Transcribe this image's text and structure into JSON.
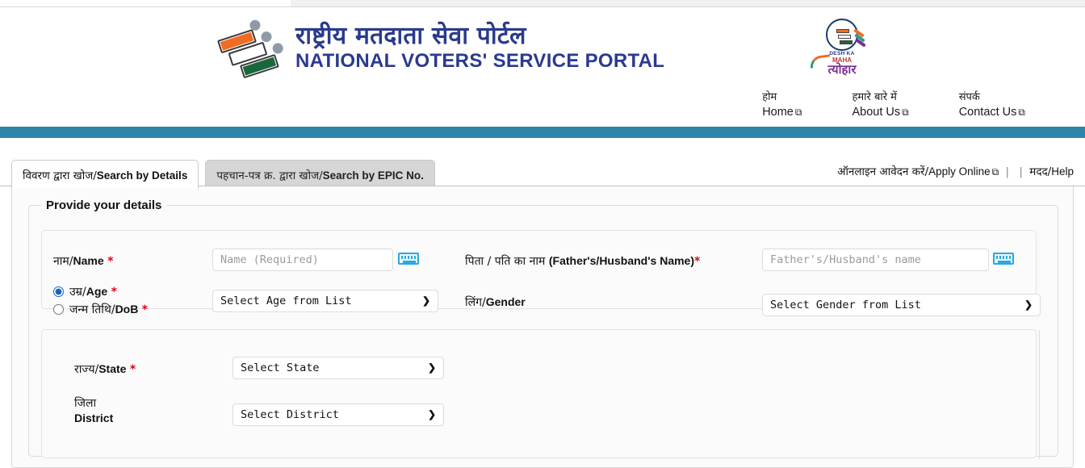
{
  "site": {
    "title_hi": "राष्ट्रीय मतदाता सेवा पोर्टल",
    "title_en": "NATIONAL VOTERS' SERVICE PORTAL",
    "logo_alt": "election-commission-of-india-logo",
    "campaign_logo": {
      "line1": "DESH KA",
      "line2": "MAHA",
      "line3": "त्योहार"
    },
    "brand_color": "#2a3a8f",
    "band_color": "#2E85AB"
  },
  "nav": {
    "items": [
      {
        "hi": "होम",
        "en": "Home",
        "external": "⧉"
      },
      {
        "hi": "हमारे बारे में",
        "en": "About Us",
        "external": "⧉"
      },
      {
        "hi": "संपर्क",
        "en": "Contact Us",
        "external": "⧉"
      }
    ]
  },
  "tabs": [
    {
      "hi": "विवरण द्वारा खोज/",
      "en": "Search by Details",
      "active": true
    },
    {
      "hi": "पहचान-पत्र क्र. द्वारा खोज/",
      "en": "Search by EPIC No.",
      "active": false
    }
  ],
  "toplinks": {
    "apply_hi": "ऑनलाइन आवेदन करें/",
    "apply_en": "Apply Online",
    "apply_ext": "⧉",
    "separator": "|",
    "help_hi": "मदद/",
    "help_en": "Help"
  },
  "form": {
    "legend": "Provide your details",
    "name": {
      "label_hi": "नाम/",
      "label_en": "Name",
      "required": "*",
      "value": "",
      "placeholder": "Name (Required)",
      "keyboard_icon": "virtual-keyboard-icon"
    },
    "father": {
      "label_hi": "पिता / पति का नाम ",
      "label_en": "(Father's/Husband's Name)",
      "required": "*",
      "value": "",
      "placeholder": "Father's/Husband's name",
      "keyboard_icon": "virtual-keyboard-icon"
    },
    "age_dob": {
      "age_hi": "उम्र/",
      "age_en": "Age",
      "age_required": "*",
      "dob_hi": "जन्म तिथि/",
      "dob_en": "DoB",
      "dob_required": "*",
      "selected": "age",
      "age_select_value": "Select Age from List"
    },
    "gender": {
      "label_hi": "लिंग/",
      "label_en": "Gender",
      "select_value": "Select Gender from List"
    },
    "state": {
      "label_hi": "राज्य/",
      "label_en": "State",
      "required": "*",
      "select_value": "Select State"
    },
    "district": {
      "label_hi": "जिला",
      "label_en": "District",
      "select_value": "Select District"
    }
  }
}
